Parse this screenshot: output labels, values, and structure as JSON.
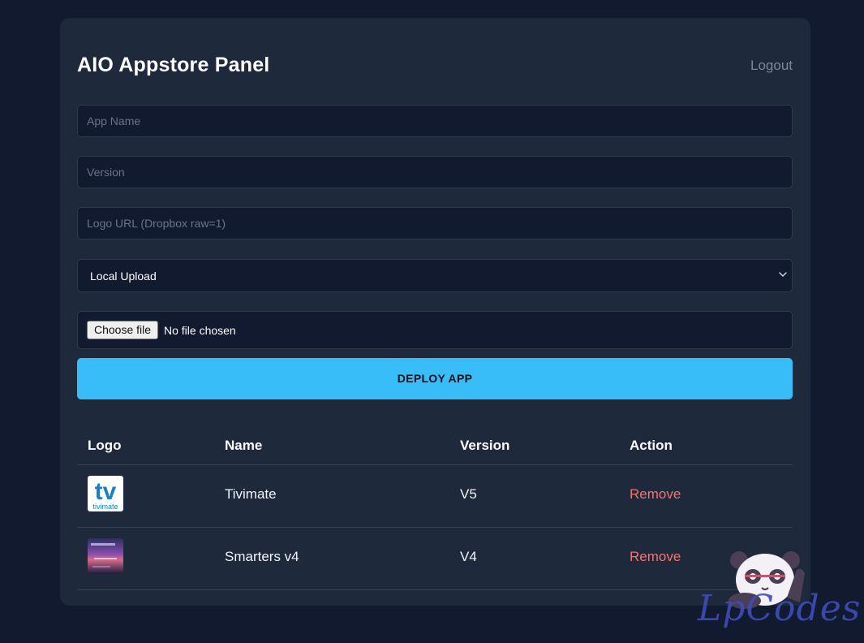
{
  "header": {
    "title": "AIO Appstore Panel",
    "logout_label": "Logout"
  },
  "form": {
    "app_name_placeholder": "App Name",
    "version_placeholder": "Version",
    "logo_url_placeholder": "Logo URL (Dropbox raw=1)",
    "source_select": {
      "selected": "Local Upload"
    },
    "file_input": {
      "button_label": "Choose file",
      "status": "No file chosen"
    },
    "deploy_label": "DEPLOY APP"
  },
  "table": {
    "headers": [
      "Logo",
      "Name",
      "Version",
      "Action"
    ],
    "rows": [
      {
        "logo_icon": "tivimate-logo",
        "name": "Tivimate",
        "version": "V5",
        "action": "Remove"
      },
      {
        "logo_icon": "smarters-logo",
        "name": "Smarters v4",
        "version": "V4",
        "action": "Remove"
      }
    ]
  },
  "watermark": {
    "text": "LpCodes",
    "tivimate_logo_text": "tivimate"
  },
  "colors": {
    "background": "#111a2e",
    "panel": "#1e293b",
    "accent": "#38bdf8",
    "danger": "#f87171",
    "muted": "#7c8797"
  }
}
